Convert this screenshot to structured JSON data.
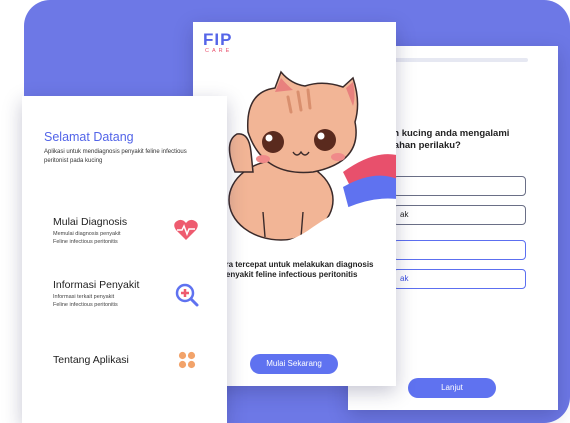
{
  "right_screen": {
    "question": "ah kucing anda mengalami\nbahan perilaku?",
    "options": [
      "",
      "ak",
      "",
      "ak"
    ],
    "next_button": "Lanjut"
  },
  "middle_screen": {
    "logo_main": "FIP",
    "logo_sub": "CARE",
    "tagline": "ara tercepat untuk melakukan diagnosis\npenyakit feline infectious peritonitis",
    "start_button": "Mulai Sekarang"
  },
  "left_screen": {
    "title": "Selamat Datang",
    "subtitle": "Aplikasi untuk mendiagnosis penyakit feline infectious peritonist pada kucing",
    "menu": [
      {
        "title": "Mulai Diagnosis",
        "desc1": "Memulai diagnosis penyakit",
        "desc2": "Feline infectious peritonitis"
      },
      {
        "title": "Informasi Penyakit",
        "desc1": "Informasi terkait penyakit",
        "desc2": "Feline infectious peritonitis"
      },
      {
        "title": "Tentang Aplikasi",
        "desc1": "",
        "desc2": ""
      }
    ]
  },
  "colors": {
    "background": "#6d78e6",
    "primary": "#5f72f0",
    "accent_red": "#e8506c",
    "accent_orange": "#f2a36a"
  }
}
